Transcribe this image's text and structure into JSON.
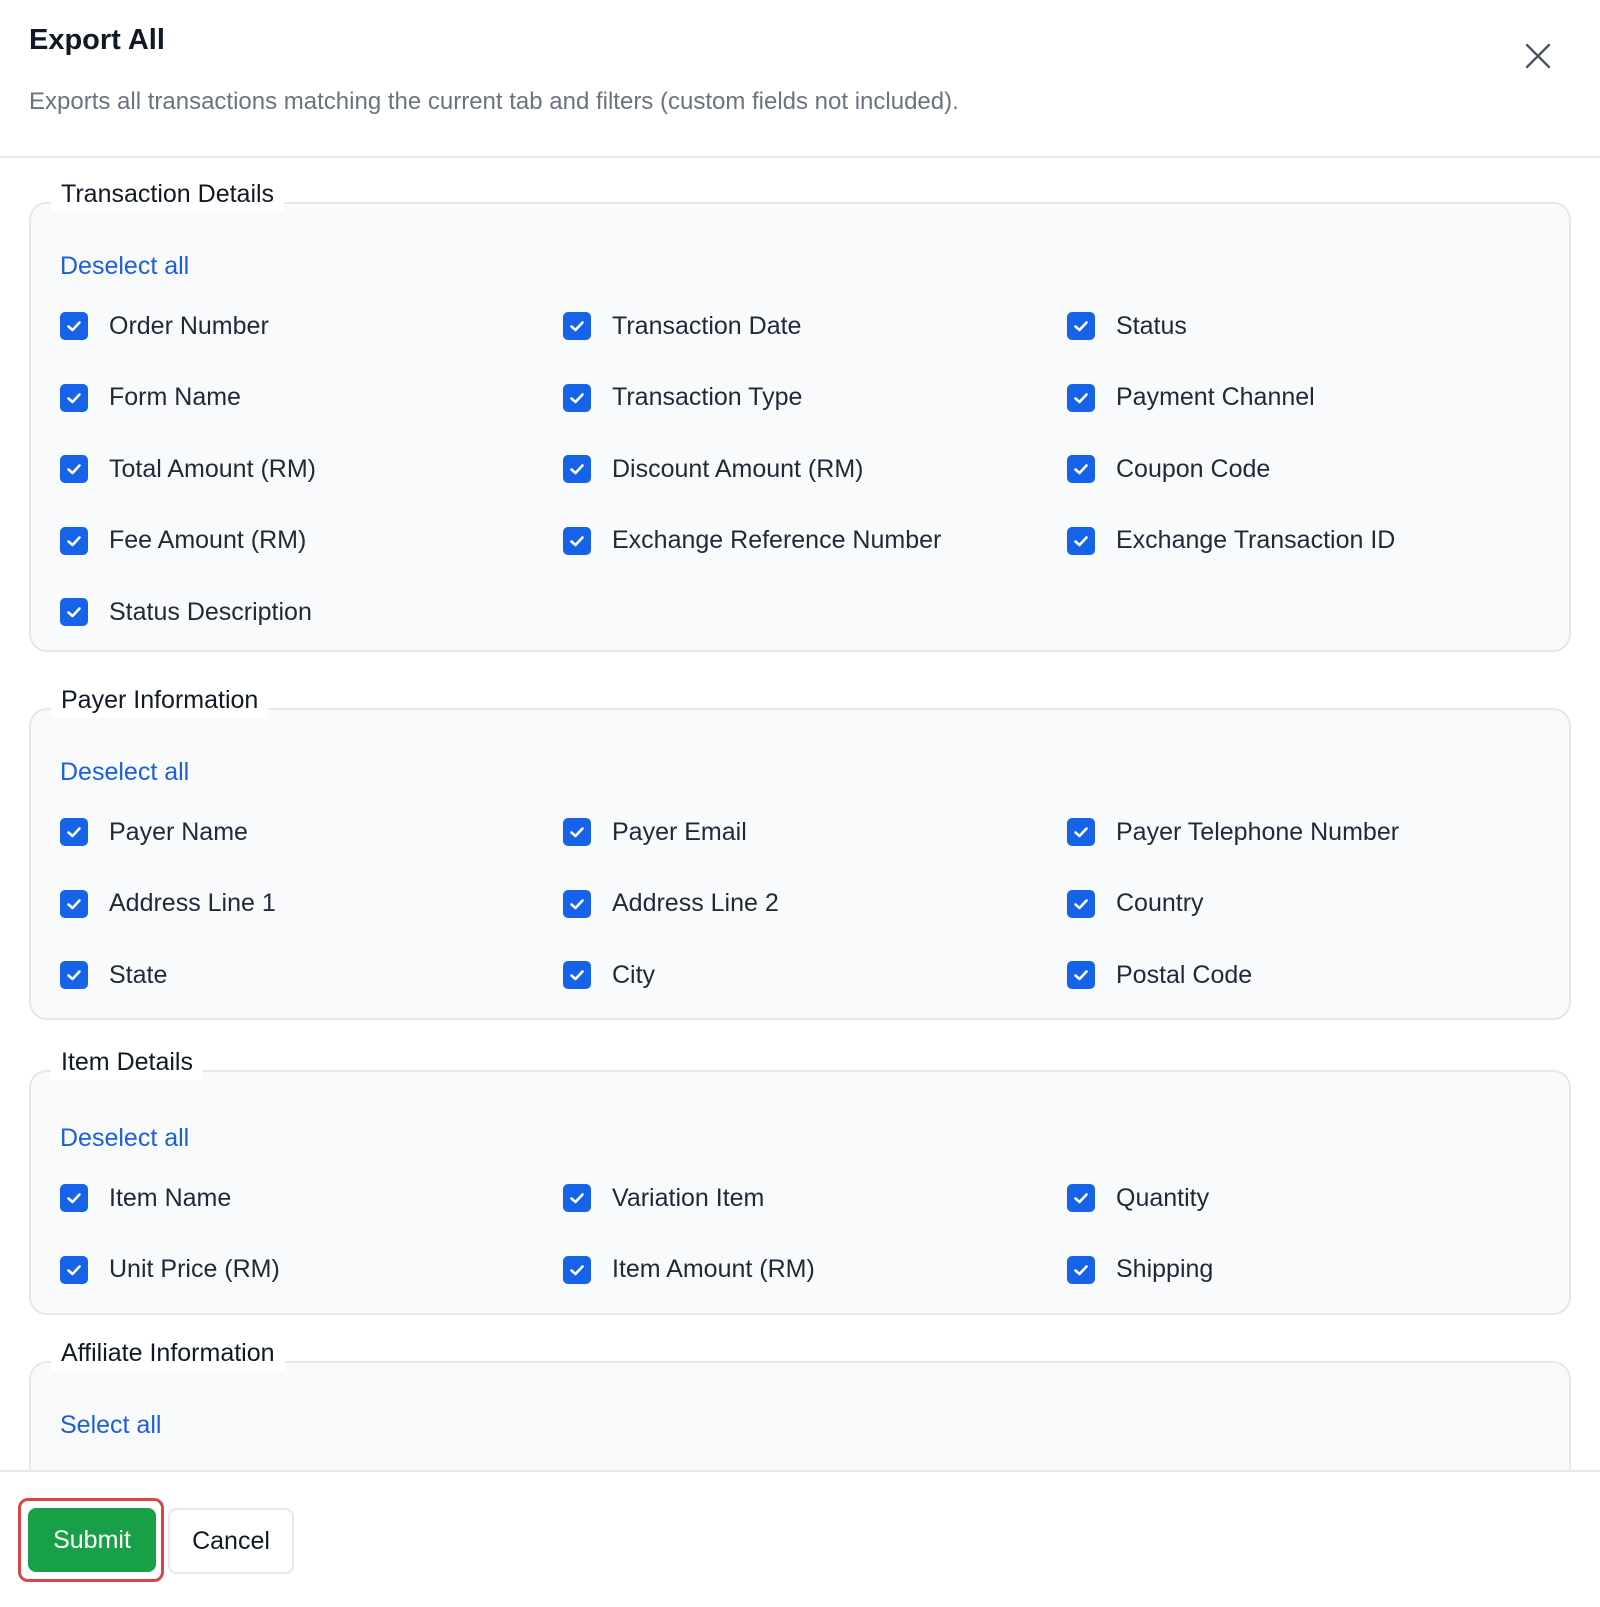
{
  "dialog": {
    "title": "Export All",
    "subtitle": "Exports all transactions matching the current tab and filters (custom fields not included).",
    "close_icon": "close-icon"
  },
  "sections": [
    {
      "legend": "Transaction Details",
      "link": "Deselect all",
      "items": [
        {
          "label": "Order Number",
          "checked": true
        },
        {
          "label": "Transaction Date",
          "checked": true
        },
        {
          "label": "Status",
          "checked": true
        },
        {
          "label": "Form Name",
          "checked": true
        },
        {
          "label": "Transaction Type",
          "checked": true
        },
        {
          "label": "Payment Channel",
          "checked": true
        },
        {
          "label": "Total Amount (RM)",
          "checked": true
        },
        {
          "label": "Discount Amount (RM)",
          "checked": true
        },
        {
          "label": "Coupon Code",
          "checked": true
        },
        {
          "label": "Fee Amount (RM)",
          "checked": true
        },
        {
          "label": "Exchange Reference Number",
          "checked": true
        },
        {
          "label": "Exchange Transaction ID",
          "checked": true
        },
        {
          "label": "Status Description",
          "checked": true
        }
      ]
    },
    {
      "legend": "Payer Information",
      "link": "Deselect all",
      "items": [
        {
          "label": "Payer Name",
          "checked": true
        },
        {
          "label": "Payer Email",
          "checked": true
        },
        {
          "label": "Payer Telephone Number",
          "checked": true
        },
        {
          "label": "Address Line 1",
          "checked": true
        },
        {
          "label": "Address Line 2",
          "checked": true
        },
        {
          "label": "Country",
          "checked": true
        },
        {
          "label": "State",
          "checked": true
        },
        {
          "label": "City",
          "checked": true
        },
        {
          "label": "Postal Code",
          "checked": true
        }
      ]
    },
    {
      "legend": "Item Details",
      "link": "Deselect all",
      "items": [
        {
          "label": "Item Name",
          "checked": true
        },
        {
          "label": "Variation Item",
          "checked": true
        },
        {
          "label": "Quantity",
          "checked": true
        },
        {
          "label": "Unit Price (RM)",
          "checked": true
        },
        {
          "label": "Item Amount (RM)",
          "checked": true
        },
        {
          "label": "Shipping",
          "checked": true
        }
      ]
    },
    {
      "legend": "Affiliate Information",
      "link": "Select all",
      "items": []
    }
  ],
  "footer": {
    "submit_label": "Submit",
    "cancel_label": "Cancel"
  },
  "colors": {
    "accent": "#1662e8",
    "link": "#1d5fd6",
    "submit": "#17a047",
    "highlight": "#d94545"
  }
}
